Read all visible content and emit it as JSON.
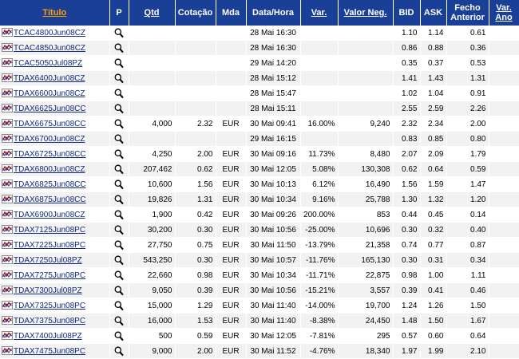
{
  "table": {
    "headers": {
      "titulo": "Título",
      "p": "P",
      "qtd": "Qtd",
      "cotacao": "Cotação",
      "mda": "Mda",
      "datahora": "Data/Hora",
      "var": "Var.",
      "valor_neg": "Valor Neg.",
      "bid": "BID",
      "ask": "ASK",
      "fecho_anterior": "Fecho Anterior",
      "var_ano": "Var. Ano"
    },
    "rows": [
      {
        "name": "TCAC4800Jun08CZ",
        "qtd": "",
        "cot": "",
        "mda": "",
        "dh": "28 Mai 16:30",
        "var": "",
        "valneg": "",
        "bid": "1.10",
        "ask": "1.14",
        "fecho": "0.61",
        "varano": ""
      },
      {
        "name": "TCAC4850Jun08CZ",
        "qtd": "",
        "cot": "",
        "mda": "",
        "dh": "28 Mai 16:30",
        "var": "",
        "valneg": "",
        "bid": "0.86",
        "ask": "0.88",
        "fecho": "0.36",
        "varano": ""
      },
      {
        "name": "TCAC5050Jul08PZ",
        "qtd": "",
        "cot": "",
        "mda": "",
        "dh": "29 Mai 14:20",
        "var": "",
        "valneg": "",
        "bid": "0.35",
        "ask": "0.37",
        "fecho": "0.53",
        "varano": ""
      },
      {
        "name": "TDAX6400Jun08CZ",
        "qtd": "",
        "cot": "",
        "mda": "",
        "dh": "28 Mai 15:12",
        "var": "",
        "valneg": "",
        "bid": "1.41",
        "ask": "1.43",
        "fecho": "1.31",
        "varano": ""
      },
      {
        "name": "TDAX6600Jun08CZ",
        "qtd": "",
        "cot": "",
        "mda": "",
        "dh": "28 Mai 15:47",
        "var": "",
        "valneg": "",
        "bid": "1.02",
        "ask": "1.04",
        "fecho": "0.91",
        "varano": ""
      },
      {
        "name": "TDAX6625Jun08CC",
        "qtd": "",
        "cot": "",
        "mda": "",
        "dh": "28 Mai 15:11",
        "var": "",
        "valneg": "",
        "bid": "2.55",
        "ask": "2.59",
        "fecho": "2.26",
        "varano": ""
      },
      {
        "name": "TDAX6675Jun08CC",
        "qtd": "4,000",
        "cot": "2.32",
        "mda": "EUR",
        "dh": "30 Mai 09:41",
        "var": "16.00%",
        "valneg": "9,240",
        "bid": "2.32",
        "ask": "2.34",
        "fecho": "2.00",
        "varano": ""
      },
      {
        "name": "TDAX6700Jun08CZ",
        "qtd": "",
        "cot": "",
        "mda": "",
        "dh": "29 Mai 16:15",
        "var": "",
        "valneg": "",
        "bid": "0.83",
        "ask": "0.85",
        "fecho": "0.80",
        "varano": ""
      },
      {
        "name": "TDAX6725Jun08CC",
        "qtd": "4,250",
        "cot": "2.00",
        "mda": "EUR",
        "dh": "30 Mai 09:16",
        "var": "11.73%",
        "valneg": "8,480",
        "bid": "2.07",
        "ask": "2.09",
        "fecho": "1.79",
        "varano": ""
      },
      {
        "name": "TDAX6800Jun08CZ",
        "qtd": "207,462",
        "cot": "0.62",
        "mda": "EUR",
        "dh": "30 Mai 12:05",
        "var": "5.08%",
        "valneg": "130,308",
        "bid": "0.62",
        "ask": "0.64",
        "fecho": "0.59",
        "varano": ""
      },
      {
        "name": "TDAX6825Jun08CC",
        "qtd": "10,600",
        "cot": "1.56",
        "mda": "EUR",
        "dh": "30 Mai 10:13",
        "var": "6.12%",
        "valneg": "16,490",
        "bid": "1.56",
        "ask": "1.59",
        "fecho": "1.47",
        "varano": ""
      },
      {
        "name": "TDAX6875Jun08CC",
        "qtd": "19,826",
        "cot": "1.31",
        "mda": "EUR",
        "dh": "30 Mai 10:34",
        "var": "9.16%",
        "valneg": "25,788",
        "bid": "1.30",
        "ask": "1.32",
        "fecho": "1.20",
        "varano": ""
      },
      {
        "name": "TDAX6900Jun08CZ",
        "qtd": "1,900",
        "cot": "0.42",
        "mda": "EUR",
        "dh": "30 Mai 09:26",
        "var": "200.00%",
        "valneg": "853",
        "bid": "0.44",
        "ask": "0.45",
        "fecho": "0.14",
        "varano": ""
      },
      {
        "name": "TDAX7125Jun08PC",
        "qtd": "30,200",
        "cot": "0.30",
        "mda": "EUR",
        "dh": "30 Mai 10:56",
        "var": "-25.00%",
        "valneg": "10,696",
        "bid": "0.30",
        "ask": "0.32",
        "fecho": "0.40",
        "varano": ""
      },
      {
        "name": "TDAX7225Jun08PC",
        "qtd": "27,750",
        "cot": "0.75",
        "mda": "EUR",
        "dh": "30 Mai 11:50",
        "var": "-13.79%",
        "valneg": "21,358",
        "bid": "0.74",
        "ask": "0.77",
        "fecho": "0.87",
        "varano": ""
      },
      {
        "name": "TDAX7250Jul08PZ",
        "qtd": "543,250",
        "cot": "0.30",
        "mda": "EUR",
        "dh": "30 Mai 10:57",
        "var": "-11.76%",
        "valneg": "165,130",
        "bid": "0.30",
        "ask": "0.31",
        "fecho": "0.34",
        "varano": ""
      },
      {
        "name": "TDAX7275Jun08PC",
        "qtd": "22,660",
        "cot": "0.98",
        "mda": "EUR",
        "dh": "30 Mai 10:34",
        "var": "-11.71%",
        "valneg": "22,875",
        "bid": "0.98",
        "ask": "1.00",
        "fecho": "1.11",
        "varano": ""
      },
      {
        "name": "TDAX7300Jul08PZ",
        "qtd": "9,050",
        "cot": "0.39",
        "mda": "EUR",
        "dh": "30 Mai 10:56",
        "var": "-15.21%",
        "valneg": "3,557",
        "bid": "0.39",
        "ask": "0.41",
        "fecho": "0.46",
        "varano": ""
      },
      {
        "name": "TDAX7325Jun08PC",
        "qtd": "15,000",
        "cot": "1.29",
        "mda": "EUR",
        "dh": "30 Mai 11:40",
        "var": "-14.00%",
        "valneg": "19,700",
        "bid": "1.24",
        "ask": "1.26",
        "fecho": "1.50",
        "varano": ""
      },
      {
        "name": "TDAX7375Jun08PC",
        "qtd": "16,000",
        "cot": "1.53",
        "mda": "EUR",
        "dh": "30 Mai 11:40",
        "var": "-8.38%",
        "valneg": "24,450",
        "bid": "1.48",
        "ask": "1.50",
        "fecho": "1.67",
        "varano": ""
      },
      {
        "name": "TDAX7400Jul08PZ",
        "qtd": "500",
        "cot": "0.59",
        "mda": "EUR",
        "dh": "30 Mai 12:05",
        "var": "-7.81%",
        "valneg": "295",
        "bid": "0.57",
        "ask": "0.60",
        "fecho": "0.64",
        "varano": ""
      },
      {
        "name": "TDAX7475Jun08PC",
        "qtd": "9,000",
        "cot": "2.00",
        "mda": "EUR",
        "dh": "30 Mai 11:52",
        "var": "-4.76%",
        "valneg": "18,340",
        "bid": "1.97",
        "ask": "1.99",
        "fecho": "2.10",
        "varano": ""
      }
    ]
  },
  "icons": {
    "row_chart": "mini-chart-icon",
    "row_view": "magnifier-icon"
  },
  "colors": {
    "header_bg": "#1a3f97",
    "header_active": "#ff9c00",
    "link": "#102a7a",
    "row_alt": "#f2f2f2"
  }
}
